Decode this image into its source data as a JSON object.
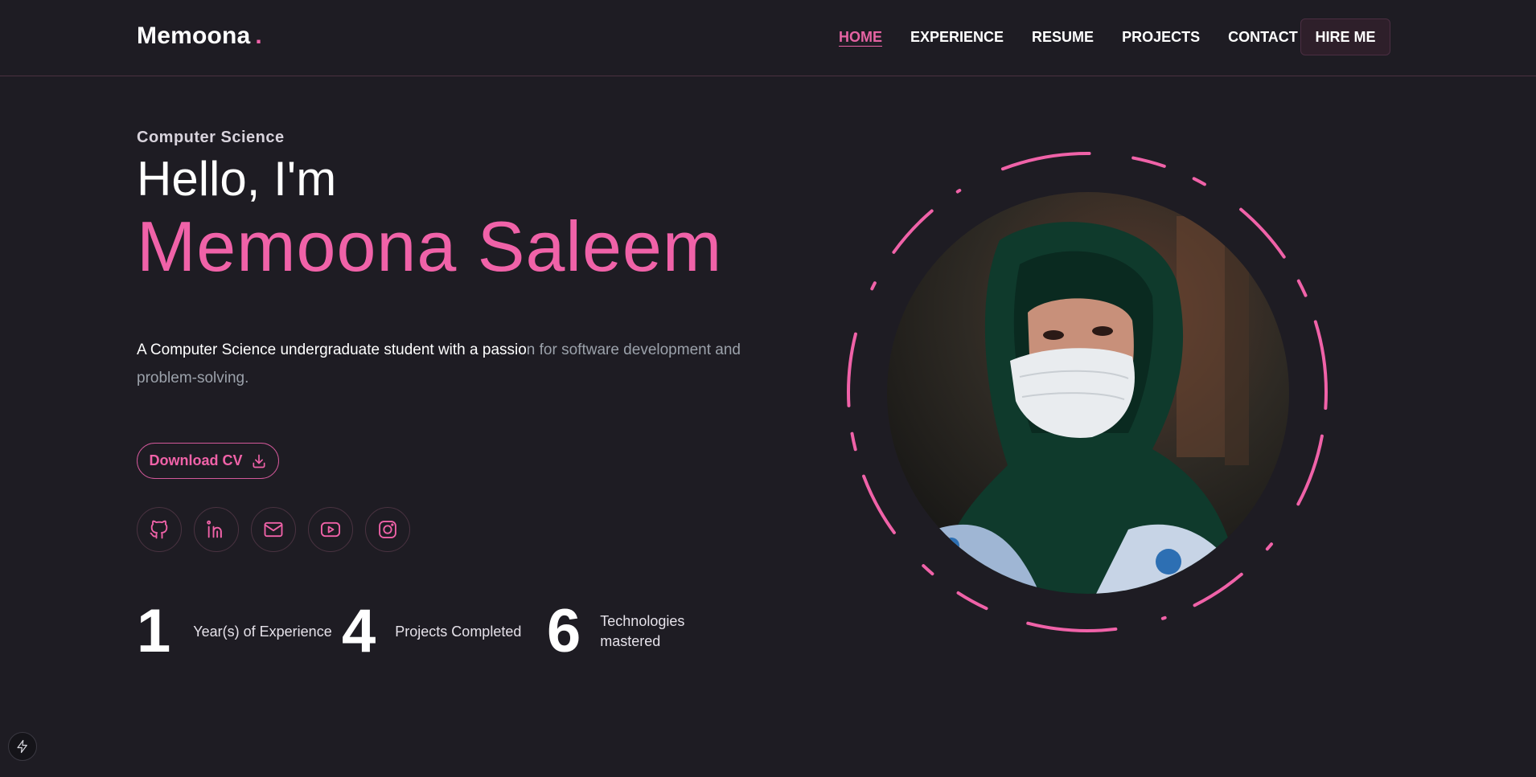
{
  "header": {
    "logo": "Memoona",
    "logo_dot": ".",
    "nav": [
      {
        "label": "HOME",
        "active": true
      },
      {
        "label": "EXPERIENCE",
        "active": false
      },
      {
        "label": "RESUME",
        "active": false
      },
      {
        "label": "PROJECTS",
        "active": false
      },
      {
        "label": "CONTACT",
        "active": false
      }
    ],
    "hire_label": "HIRE ME"
  },
  "hero": {
    "subtitle": "Computer Science",
    "greeting": "Hello, I'm",
    "name": "Memoona Saleem",
    "description_highlight": "A Computer Science undergraduate student with a passio",
    "description_rest": "n for software development and problem-solving.",
    "download_label": "Download CV",
    "download_icon": "download-icon"
  },
  "socials": [
    {
      "name": "github-icon"
    },
    {
      "name": "linkedin-icon"
    },
    {
      "name": "mail-icon"
    },
    {
      "name": "youtube-icon"
    },
    {
      "name": "instagram-icon"
    }
  ],
  "stats": [
    {
      "value": "1",
      "label": "Year(s) of Experience"
    },
    {
      "value": "4",
      "label": "Projects Completed"
    },
    {
      "value": "6",
      "label": "Technologies mastered"
    }
  ],
  "colors": {
    "background": "#1e1c23",
    "accent": "#f062a8",
    "muted_text": "#9ba1aa"
  }
}
